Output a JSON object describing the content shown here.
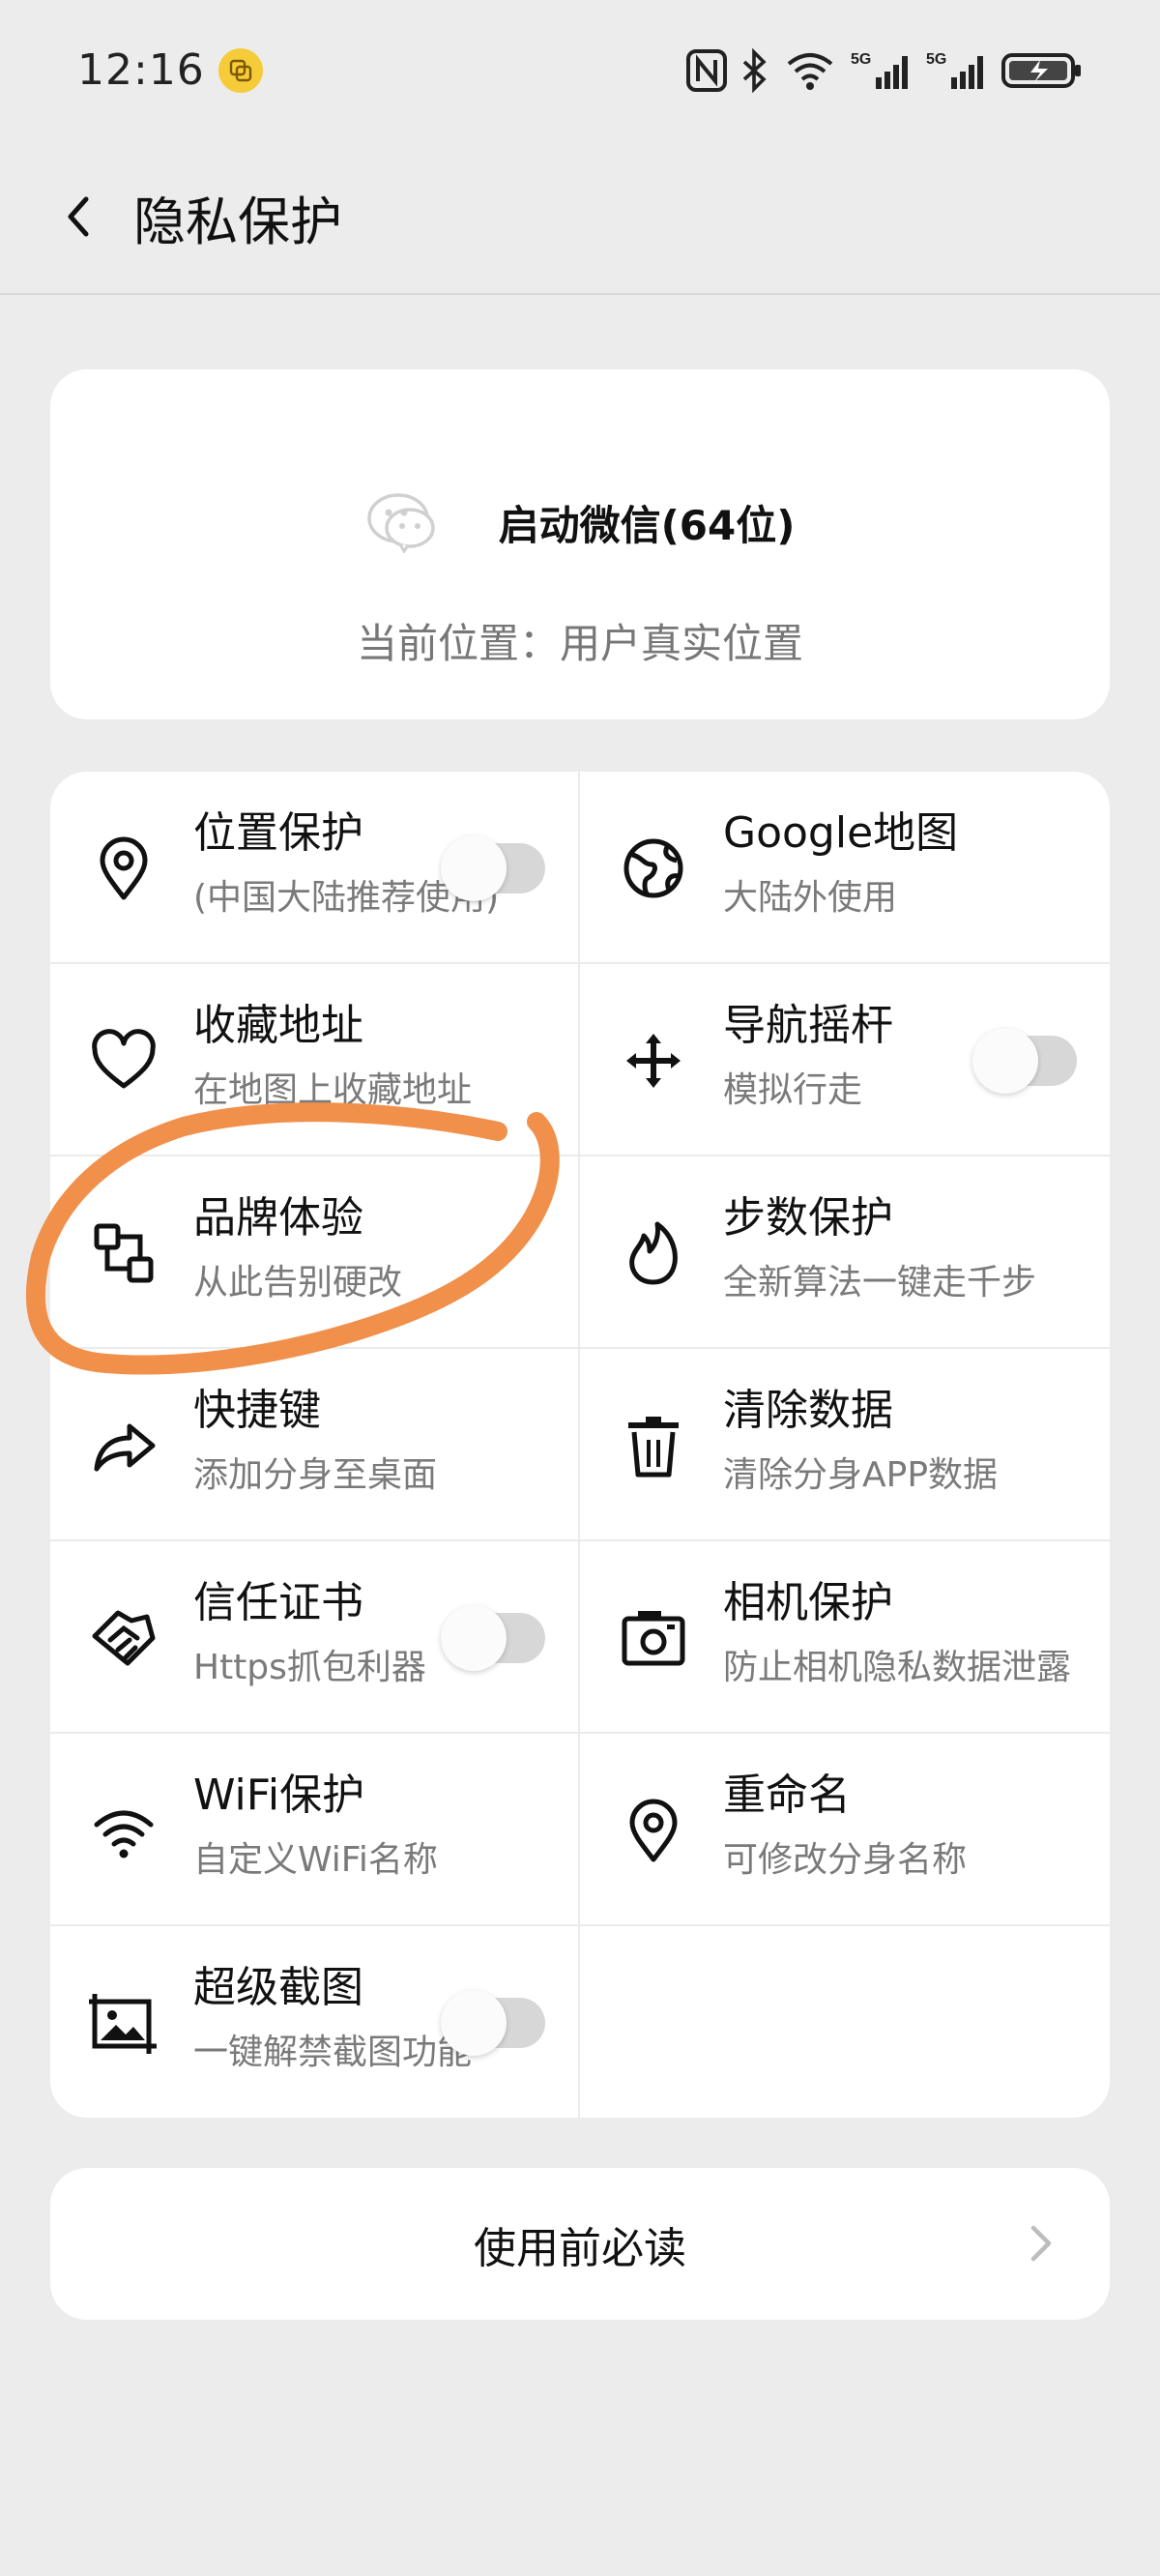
{
  "status_bar": {
    "time": "12:16",
    "icons": [
      "nfc-icon",
      "bluetooth-icon",
      "wifi-icon",
      "signal-5g-icon",
      "signal-5g-icon",
      "battery-charging-icon"
    ]
  },
  "header": {
    "title": "隐私保护",
    "back_icon": "chevron-left-icon"
  },
  "launch": {
    "icon": "wechat-icon",
    "title": "启动微信(64位)",
    "location": "当前位置：用户真实位置"
  },
  "features": [
    {
      "title": "位置保护",
      "subtitle": "(中国大陆推荐使用)",
      "icon": "location-pin-icon",
      "toggle": true,
      "enabled": false
    },
    {
      "title": "Google地图",
      "subtitle": "大陆外使用",
      "icon": "globe-icon",
      "toggle": false
    },
    {
      "title": "收藏地址",
      "subtitle": "在地图上收藏地址",
      "icon": "heart-icon",
      "toggle": false
    },
    {
      "title": "导航摇杆",
      "subtitle": "模拟行走",
      "icon": "move-arrows-icon",
      "toggle": true,
      "enabled": false
    },
    {
      "title": "品牌体验",
      "subtitle": "从此告别硬改",
      "icon": "swap-squares-icon",
      "toggle": false
    },
    {
      "title": "步数保护",
      "subtitle": "全新算法一键走千步",
      "icon": "flame-icon",
      "toggle": false
    },
    {
      "title": "快捷键",
      "subtitle": "添加分身至桌面",
      "icon": "share-arrow-icon",
      "toggle": false
    },
    {
      "title": "清除数据",
      "subtitle": "清除分身APP数据",
      "icon": "trash-icon",
      "toggle": false
    },
    {
      "title": "信任证书",
      "subtitle": "Https抓包利器",
      "icon": "handshake-icon",
      "toggle": true,
      "enabled": false
    },
    {
      "title": "相机保护",
      "subtitle": "防止相机隐私数据泄露",
      "icon": "camera-icon",
      "toggle": false
    },
    {
      "title": "WiFi保护",
      "subtitle": "自定义WiFi名称",
      "icon": "wifi-icon",
      "toggle": false
    },
    {
      "title": "重命名",
      "subtitle": "可修改分身名称",
      "icon": "location-pin-icon",
      "toggle": false
    },
    {
      "title": "超级截图",
      "subtitle": "一键解禁截图功能",
      "icon": "screenshot-icon",
      "toggle": true,
      "enabled": false
    }
  ],
  "notice": {
    "label": "使用前必读",
    "arrow_icon": "chevron-right-icon"
  },
  "colors": {
    "background": "#ececec",
    "card": "#ffffff",
    "annotation": "#f0904a",
    "toggle_off": "#d7d7d7",
    "status_badge": "#f6cb3a"
  }
}
